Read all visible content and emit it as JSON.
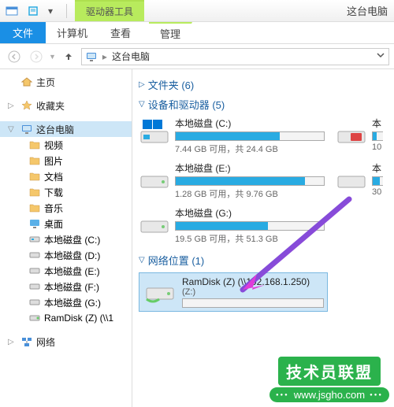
{
  "titlebar": {
    "context_tab": "驱动器工具",
    "window_title": "这台电脑"
  },
  "ribbon": {
    "file": "文件",
    "tabs": [
      "计算机",
      "查看"
    ],
    "context_tab": "管理"
  },
  "addressbar": {
    "crumb": "这台电脑"
  },
  "navpane": {
    "home": "主页",
    "favorites": "收藏夹",
    "this_pc": "这台电脑",
    "children": [
      {
        "label": "视频"
      },
      {
        "label": "图片"
      },
      {
        "label": "文档"
      },
      {
        "label": "下载"
      },
      {
        "label": "音乐"
      },
      {
        "label": "桌面"
      },
      {
        "label": "本地磁盘 (C:)"
      },
      {
        "label": "本地磁盘 (D:)"
      },
      {
        "label": "本地磁盘 (E:)"
      },
      {
        "label": "本地磁盘 (F:)"
      },
      {
        "label": "本地磁盘 (G:)"
      },
      {
        "label": "RamDisk (Z) (\\\\1"
      }
    ],
    "network": "网络"
  },
  "content": {
    "folders_header": "文件夹 (6)",
    "drives_header": "设备和驱动器 (5)",
    "netloc_header": "网络位置 (1)",
    "drives": [
      {
        "name": "本地磁盘 (C:)",
        "fill": 70,
        "stats": "7.44 GB 可用，共 24.4 GB"
      },
      {
        "name": "本",
        "fill": 0,
        "stats": "10"
      },
      {
        "name": "本地磁盘 (E:)",
        "fill": 87,
        "stats": "1.28 GB 可用，共 9.76 GB"
      },
      {
        "name": "本",
        "fill": 0,
        "stats": "30"
      },
      {
        "name": "本地磁盘 (G:)",
        "fill": 62,
        "stats": "19.5 GB 可用，共 51.3 GB"
      }
    ],
    "netloc": {
      "name": "RamDisk (Z) (\\\\192.168.1.250)",
      "sub": "(Z:)"
    }
  },
  "watermark": {
    "title": "技术员联盟",
    "url": "www.jsgho.com"
  }
}
